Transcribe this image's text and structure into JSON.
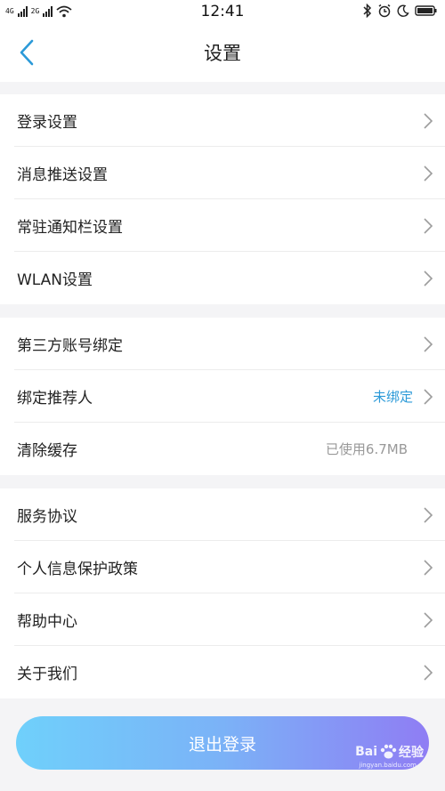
{
  "status_bar": {
    "network_1": "4G",
    "network_2": "2G",
    "time": "12:41"
  },
  "header": {
    "title": "设置",
    "back_icon": "chevron-left-icon"
  },
  "groups": [
    {
      "items": [
        {
          "label": "登录设置",
          "value": "",
          "chevron": true
        },
        {
          "label": "消息推送设置",
          "value": "",
          "chevron": true
        },
        {
          "label": "常驻通知栏设置",
          "value": "",
          "chevron": true
        },
        {
          "label": "WLAN设置",
          "value": "",
          "chevron": true
        }
      ]
    },
    {
      "items": [
        {
          "label": "第三方账号绑定",
          "value": "",
          "chevron": true
        },
        {
          "label": "绑定推荐人",
          "value": "未绑定",
          "chevron": true
        },
        {
          "label": "清除缓存",
          "value": "已使用6.7MB",
          "chevron": false
        }
      ]
    },
    {
      "items": [
        {
          "label": "服务协议",
          "value": "",
          "chevron": true
        },
        {
          "label": "个人信息保护政策",
          "value": "",
          "chevron": true
        },
        {
          "label": "帮助中心",
          "value": "",
          "chevron": true
        },
        {
          "label": "关于我们",
          "value": "",
          "chevron": true
        }
      ]
    }
  ],
  "logout_label": "退出登录",
  "watermark": {
    "brand": "Bai",
    "brand_suffix": "经验",
    "url": "jingyan.baidu.com"
  },
  "colors": {
    "accent_blue": "#2c9ad8",
    "back_icon": "#2c9ad8",
    "button_gradient_start": "#6fd0fb",
    "button_gradient_end": "#8f7df4"
  }
}
